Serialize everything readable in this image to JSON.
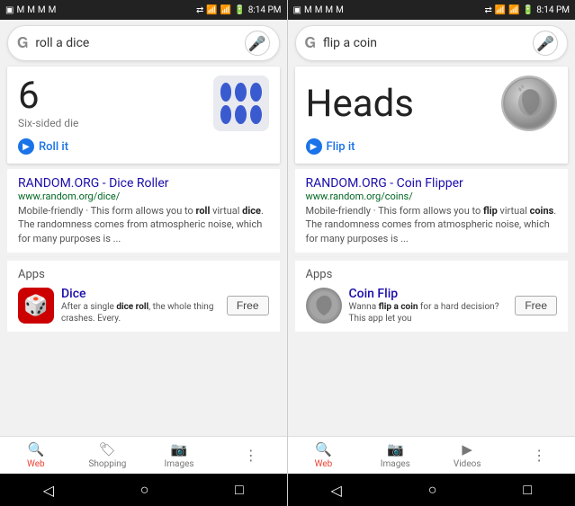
{
  "left": {
    "status": {
      "time": "8:14 PM",
      "icons_left": [
        "📱",
        "✉",
        "✉",
        "✉",
        "✉"
      ],
      "icons_right": [
        "📶",
        "🔋"
      ]
    },
    "search": {
      "query": "roll a dice",
      "mic_label": "mic"
    },
    "card": {
      "result_number": "6",
      "result_sub": "Six-sided die",
      "action_label": "Roll it"
    },
    "search_result": {
      "title": "RANDOM.ORG - Dice Roller",
      "url": "www.random.org/dice/",
      "desc": "Mobile-friendly · This form allows you to roll virtual dice. The randomness comes from atmospheric noise, which for many purposes is ..."
    },
    "apps_section": {
      "label": "Apps",
      "app_name": "Dice",
      "app_desc": "After a single dice roll, the whole thing crashes. Every.",
      "free_label": "Free"
    },
    "bottom_nav": {
      "web": "Web",
      "shopping": "Shopping",
      "images": "Images",
      "more": "⋮"
    }
  },
  "right": {
    "status": {
      "time": "8:14 PM"
    },
    "search": {
      "query": "flip a coin",
      "mic_label": "mic"
    },
    "card": {
      "result_text": "Heads",
      "action_label": "Flip it"
    },
    "search_result": {
      "title": "RANDOM.ORG - Coin Flipper",
      "url": "www.random.org/coins/",
      "desc": "Mobile-friendly · This form allows you to flip virtual coins. The randomness comes from atmospheric noise, which for many purposes is ..."
    },
    "apps_section": {
      "label": "Apps",
      "app_name": "Coin Flip",
      "app_desc": "Wanna flip a coin for a hard decision? This app let you",
      "free_label": "Free"
    },
    "bottom_nav": {
      "web": "Web",
      "images": "Images",
      "videos": "Videos",
      "more": "⋮"
    }
  }
}
